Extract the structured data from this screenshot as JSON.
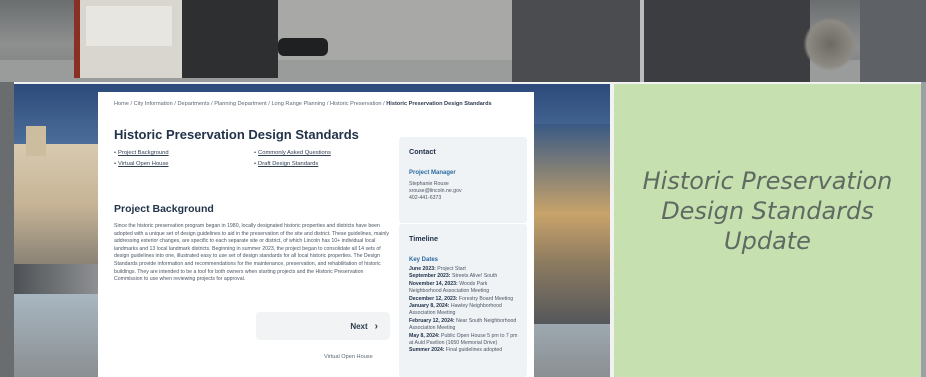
{
  "breadcrumb": {
    "items": [
      "Home",
      "City Information",
      "Departments",
      "Planning Department",
      "Long Range Planning",
      "Historic Preservation"
    ],
    "separator": "/",
    "current": "Historic Preservation Design Standards"
  },
  "page_title": "Historic Preservation Design Standards",
  "links": [
    "Project Background",
    "Commonly Asked Questions",
    "Virtual Open House",
    "Draft Design Standards"
  ],
  "section": {
    "title": "Project Background",
    "body": "Since the historic preservation program began in 1980, locally designated historic properties and districts have been adopted with a unique set of design guidelines to aid in the preservation of the site and district. These guidelines, mainly addressing exterior changes, are specific to each separate site or district, of which Lincoln has 10+ individual local landmarks and 13 local landmark districts. Beginning in summer 2023, the project began to consolidate all 14 sets of design guidelines into one, illustrated easy to use set of design standards for all local historic properties. The Design Standards provide information and recommendations for the maintenance, preservation, and rehabilitation of historic buildings. They are intended to be a tool for both owners when starting projects and the Historic Preservation Commission to use when reviewing projects for approval."
  },
  "next": {
    "label": "Next",
    "icon": "chevron-right-icon",
    "sub_label": "Virtual Open House"
  },
  "contact": {
    "title": "Contact",
    "role": "Project Manager",
    "name": "Stephanie Rouse",
    "email": "srouse@lincoln.ne.gov",
    "phone": "402-441-6373"
  },
  "timeline": {
    "title": "Timeline",
    "subtitle": "Key Dates",
    "items": [
      {
        "date": "June 2023:",
        "text": "Project Start"
      },
      {
        "date": "September 2023:",
        "text": "Streets Alive! South"
      },
      {
        "date": "November 14, 2023:",
        "text": "Woods Park Neighborhood Association Meeting"
      },
      {
        "date": "December 12, 2023:",
        "text": "Forestry Board Meeting"
      },
      {
        "date": "January 8, 2024:",
        "text": "Hawley Neighborhood Association Meeting"
      },
      {
        "date": "February 12, 2024:",
        "text": "Near South Neighborhood Association Meeting"
      },
      {
        "date": "May 8, 2024:",
        "text": "Public Open House 5 pm to 7 pm at Auld Pavilion (1650 Memorial Drive)"
      },
      {
        "date": "Summer 2024:",
        "text": "Final guidelines adopted"
      }
    ]
  },
  "panel": {
    "title": "Historic Preservation Design Standards Update",
    "background": "#c7e0b0"
  }
}
